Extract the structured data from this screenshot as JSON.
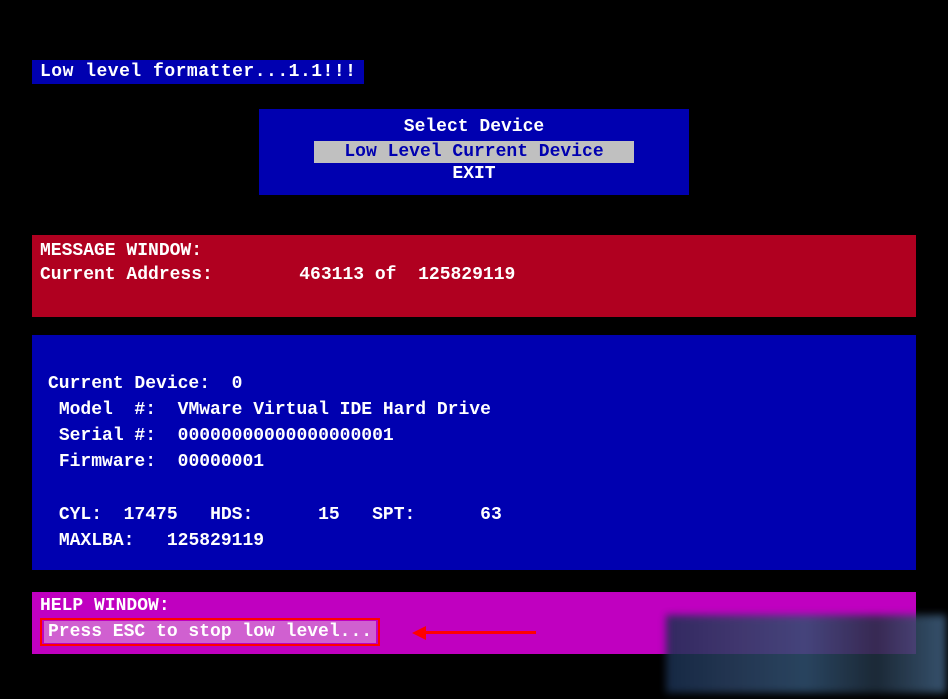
{
  "title": "Low level formatter...1.1!!!",
  "menu": {
    "heading": "Select Device",
    "items": [
      {
        "label": "Low Level Current Device",
        "selected": true
      },
      {
        "label": "EXIT",
        "selected": false
      }
    ]
  },
  "message_window": {
    "label": "MESSAGE WINDOW:",
    "address_label": "Current Address:",
    "current_address": "463113",
    "of_label": "of",
    "total_address": "125829119"
  },
  "device_info": {
    "current_device_label": "Current Device:",
    "current_device": "0",
    "model_label": "Model  #:",
    "model": "VMware Virtual IDE Hard Drive",
    "serial_label": "Serial #:",
    "serial": "00000000000000000001",
    "firmware_label": "Firmware:",
    "firmware": "00000001",
    "cyl_label": "CYL:",
    "cyl": "17475",
    "hds_label": "HDS:",
    "hds": "15",
    "spt_label": "SPT:",
    "spt": "63",
    "maxlba_label": "MAXLBA:",
    "maxlba": "125829119"
  },
  "help_window": {
    "label": "HELP WINDOW:",
    "message": "Press ESC to stop low level..."
  }
}
